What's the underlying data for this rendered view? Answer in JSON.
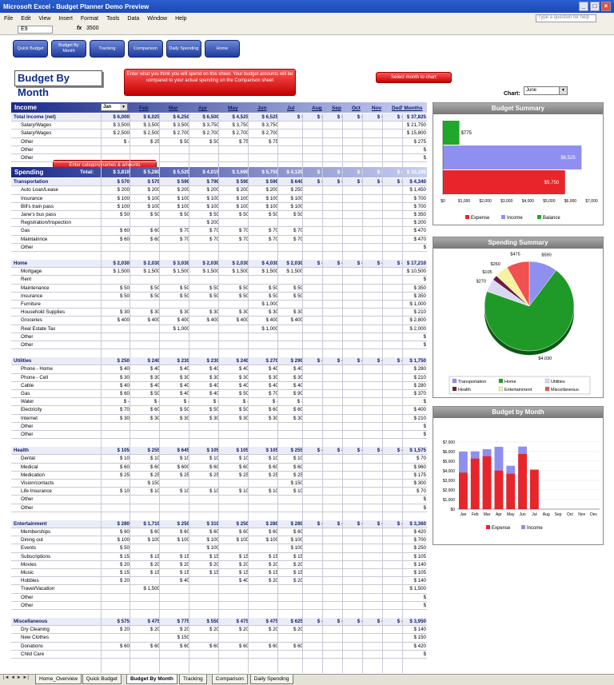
{
  "window": {
    "title": "Microsoft Excel - Budget Planner Demo Preview"
  },
  "menu": [
    "File",
    "Edit",
    "View",
    "Insert",
    "Format",
    "Tools",
    "Data",
    "Window",
    "Help"
  ],
  "ask_placeholder": "Type a question for help",
  "formula": {
    "namebox": "E9",
    "fx": "fx",
    "value": "3500"
  },
  "nav": [
    "Quick Budget",
    "Budget By Month",
    "Tracking",
    "Comparison",
    "Daily Spending",
    "Home"
  ],
  "page_title": "Budget By Month",
  "callouts": {
    "main": "Enter what you think you will spend on this sheet. Your budget amounts will be compared to your actual spending on the Comparison sheet",
    "select": "Select month to chart",
    "category": "Enter category names & amounts"
  },
  "chart_select": {
    "label": "Chart:",
    "value": "June"
  },
  "months": [
    "Jan",
    "Feb",
    "Mar",
    "Apr",
    "May",
    "Jun",
    "Jul",
    "Aug",
    "Sep",
    "Oct",
    "Nov",
    "Dec",
    "7 Months"
  ],
  "income": {
    "header": "Income",
    "month_select": "Jan",
    "rows": [
      {
        "label": "Total Income (net)",
        "tot": true,
        "vals": [
          "$ 6,000",
          "$ 6,025",
          "$ 6,250",
          "$ 6,500",
          "$ 4,525",
          "$ 6,525",
          "$ -",
          "$ -",
          "$ -",
          "$ -",
          "$ -",
          "$ -"
        ],
        "ytd": "$ 37,825"
      },
      {
        "label": "Salary/Wages",
        "vals": [
          "$ 3,500",
          "$ 3,500",
          "$ 3,500",
          "$ 3,750",
          "$ 3,750",
          "$ 3,750",
          "",
          "",
          "",
          "",
          "",
          ""
        ],
        "ytd": "$ 21,750"
      },
      {
        "label": "Salary/Wages",
        "vals": [
          "$ 2,500",
          "$ 2,500",
          "$ 2,700",
          "$ 2,700",
          "$ 2,700",
          "$ 2,700",
          "",
          "",
          "",
          "",
          "",
          ""
        ],
        "ytd": "$ 15,800"
      },
      {
        "label": "Other",
        "vals": [
          "$ -",
          "$ 25",
          "$ 50",
          "$ 50",
          "$ 75",
          "$ 75",
          "",
          "",
          "",
          "",
          "",
          ""
        ],
        "ytd": "$ 275"
      },
      {
        "label": "Other",
        "vals": [
          "",
          "",
          "",
          "",
          "",
          "",
          "",
          "",
          "",
          "",
          "",
          ""
        ],
        "ytd": "$"
      },
      {
        "label": "Other",
        "vals": [
          "",
          "",
          "",
          "",
          "",
          "",
          "",
          "",
          "",
          "",
          "",
          ""
        ],
        "ytd": "$"
      }
    ]
  },
  "spending_header": {
    "label": "Spending",
    "total_label": "Total:",
    "vals": [
      "$ 3,810",
      "$ 5,280",
      "$ 5,520",
      "$ 4,015",
      "$ 3,690",
      "$ 5,750",
      "$ 4,120",
      "$ -",
      "$ -",
      "$ -",
      "$ -",
      "$ -"
    ],
    "ytd": "$ 32,185"
  },
  "groups": [
    {
      "name": "Transportation",
      "vals": [
        "$ 570",
        "$ 570",
        "$ 590",
        "$ 790",
        "$ 590",
        "$ 590",
        "$ 640",
        "$ -",
        "$ -",
        "$ -",
        "$ -",
        "$ -"
      ],
      "ytd": "$ 4,340",
      "rows": [
        {
          "label": "Auto Loan/Lease",
          "vals": [
            "$ 200",
            "$ 200",
            "$ 200",
            "$ 200",
            "$ 200",
            "$ 200",
            "$ 250"
          ],
          "ytd": "$ 1,450"
        },
        {
          "label": "Insurance",
          "vals": [
            "$ 100",
            "$ 100",
            "$ 100",
            "$ 100",
            "$ 100",
            "$ 100",
            "$ 100"
          ],
          "ytd": "$ 700"
        },
        {
          "label": "Bill's train pass",
          "vals": [
            "$ 100",
            "$ 100",
            "$ 100",
            "$ 100",
            "$ 100",
            "$ 100",
            "$ 100"
          ],
          "ytd": "$ 700"
        },
        {
          "label": "Jane's bus pass",
          "vals": [
            "$ 50",
            "$ 50",
            "$ 50",
            "$ 50",
            "$ 50",
            "$ 50",
            "$ 50"
          ],
          "ytd": "$ 350"
        },
        {
          "label": "Registration/Inspection",
          "vals": [
            "",
            "",
            "",
            "$ 200",
            "",
            "",
            ""
          ],
          "ytd": "$ 200"
        },
        {
          "label": "Gas",
          "vals": [
            "$ 60",
            "$ 60",
            "$ 70",
            "$ 70",
            "$ 70",
            "$ 70",
            "$ 70"
          ],
          "ytd": "$ 470"
        },
        {
          "label": "Maintainnce",
          "vals": [
            "$ 60",
            "$ 60",
            "$ 70",
            "$ 70",
            "$ 70",
            "$ 70",
            "$ 70"
          ],
          "ytd": "$ 470"
        },
        {
          "label": "Other",
          "vals": [],
          "ytd": "$"
        }
      ]
    },
    {
      "name": "Home",
      "vals": [
        "$ 2,030",
        "$ 2,030",
        "$ 3,030",
        "$ 2,030",
        "$ 2,030",
        "$ 4,030",
        "$ 2,030",
        "$ -",
        "$ -",
        "$ -",
        "$ -",
        "$ -"
      ],
      "ytd": "$ 17,210",
      "rows": [
        {
          "label": "Mortgage",
          "vals": [
            "$ 1,500",
            "$ 1,500",
            "$ 1,500",
            "$ 1,500",
            "$ 1,500",
            "$ 1,500",
            "$ 1,500"
          ],
          "ytd": "$ 10,500"
        },
        {
          "label": "Rent",
          "vals": [],
          "ytd": "$"
        },
        {
          "label": "Maintenance",
          "vals": [
            "$ 50",
            "$ 50",
            "$ 50",
            "$ 50",
            "$ 50",
            "$ 50",
            "$ 50"
          ],
          "ytd": "$ 350"
        },
        {
          "label": "Insurance",
          "vals": [
            "$ 50",
            "$ 50",
            "$ 50",
            "$ 50",
            "$ 50",
            "$ 50",
            "$ 50"
          ],
          "ytd": "$ 350"
        },
        {
          "label": "Furniture",
          "vals": [
            "",
            "",
            "",
            "",
            "",
            "$ 1,000",
            ""
          ],
          "ytd": "$ 1,000"
        },
        {
          "label": "Household Supplies",
          "vals": [
            "$ 30",
            "$ 30",
            "$ 30",
            "$ 30",
            "$ 30",
            "$ 30",
            "$ 30"
          ],
          "ytd": "$ 210"
        },
        {
          "label": "Groceries",
          "vals": [
            "$ 400",
            "$ 400",
            "$ 400",
            "$ 400",
            "$ 400",
            "$ 400",
            "$ 400"
          ],
          "ytd": "$ 2,800"
        },
        {
          "label": "Real Estate Tax",
          "vals": [
            "",
            "",
            "$ 1,000",
            "",
            "",
            "$ 1,000",
            ""
          ],
          "ytd": "$ 2,000"
        },
        {
          "label": "Other",
          "vals": [],
          "ytd": "$"
        },
        {
          "label": "Other",
          "vals": [],
          "ytd": "$"
        }
      ]
    },
    {
      "name": "Utilities",
      "vals": [
        "$ 250",
        "$ 240",
        "$ 230",
        "$ 230",
        "$ 240",
        "$ 270",
        "$ 290",
        "$ -",
        "$ -",
        "$ -",
        "$ -",
        "$ -"
      ],
      "ytd": "$ 1,750",
      "rows": [
        {
          "label": "Phone - Home",
          "vals": [
            "$ 40",
            "$ 40",
            "$ 40",
            "$ 40",
            "$ 40",
            "$ 40",
            "$ 40"
          ],
          "ytd": "$ 280"
        },
        {
          "label": "Phone - Cell",
          "vals": [
            "$ 30",
            "$ 30",
            "$ 30",
            "$ 30",
            "$ 30",
            "$ 30",
            "$ 30"
          ],
          "ytd": "$ 210"
        },
        {
          "label": "Cable",
          "vals": [
            "$ 40",
            "$ 40",
            "$ 40",
            "$ 40",
            "$ 40",
            "$ 40",
            "$ 40"
          ],
          "ytd": "$ 280"
        },
        {
          "label": "Gas",
          "vals": [
            "$ 60",
            "$ 50",
            "$ 40",
            "$ 40",
            "$ 50",
            "$ 70",
            "$ 90"
          ],
          "ytd": "$ 370"
        },
        {
          "label": "Water",
          "vals": [
            "$ -",
            "$ -",
            "$ -",
            "$ -",
            "$ -",
            "$ -",
            "$ -"
          ],
          "ytd": "$"
        },
        {
          "label": "Electricity",
          "vals": [
            "$ 70",
            "$ 60",
            "$ 50",
            "$ 50",
            "$ 50",
            "$ 60",
            "$ 60"
          ],
          "ytd": "$ 400"
        },
        {
          "label": "Internet",
          "vals": [
            "$ 30",
            "$ 30",
            "$ 30",
            "$ 30",
            "$ 30",
            "$ 30",
            "$ 30"
          ],
          "ytd": "$ 210"
        },
        {
          "label": "Other",
          "vals": [],
          "ytd": "$"
        },
        {
          "label": "Other",
          "vals": [],
          "ytd": "$"
        }
      ]
    },
    {
      "name": "Health",
      "vals": [
        "$ 105",
        "$ 255",
        "$ 645",
        "$ 105",
        "$ 105",
        "$ 105",
        "$ 255",
        "$ -",
        "$ -",
        "$ -",
        "$ -",
        "$ -"
      ],
      "ytd": "$ 1,575",
      "rows": [
        {
          "label": "Dental",
          "vals": [
            "$ 10",
            "$ 10",
            "$ 10",
            "$ 10",
            "$ 10",
            "$ 10",
            "$ 10"
          ],
          "ytd": "$ 70"
        },
        {
          "label": "Medical",
          "vals": [
            "$ 60",
            "$ 60",
            "$ 600",
            "$ 60",
            "$ 60",
            "$ 60",
            "$ 60"
          ],
          "ytd": "$ 960"
        },
        {
          "label": "Medication",
          "vals": [
            "$ 25",
            "$ 25",
            "$ 25",
            "$ 25",
            "$ 25",
            "$ 25",
            "$ 25"
          ],
          "ytd": "$ 175"
        },
        {
          "label": "Vision/contacts",
          "vals": [
            "",
            "$ 150",
            "",
            "",
            "",
            "",
            "$ 150"
          ],
          "ytd": "$ 300"
        },
        {
          "label": "Life Insurance",
          "vals": [
            "$ 10",
            "$ 10",
            "$ 10",
            "$ 10",
            "$ 10",
            "$ 10",
            "$ 10"
          ],
          "ytd": "$ 70"
        },
        {
          "label": "Other",
          "vals": [],
          "ytd": "$"
        },
        {
          "label": "Other",
          "vals": [],
          "ytd": "$"
        }
      ]
    },
    {
      "name": "Entertainment",
      "vals": [
        "$ 280",
        "$ 1,710",
        "$ 250",
        "$ 310",
        "$ 250",
        "$ 280",
        "$ 280",
        "$ -",
        "$ -",
        "$ -",
        "$ -",
        "$ -"
      ],
      "ytd": "$ 3,360",
      "rows": [
        {
          "label": "Memberships",
          "vals": [
            "$ 60",
            "$ 60",
            "$ 60",
            "$ 60",
            "$ 60",
            "$ 60",
            "$ 60"
          ],
          "ytd": "$ 420"
        },
        {
          "label": "Dining out",
          "vals": [
            "$ 100",
            "$ 100",
            "$ 100",
            "$ 100",
            "$ 100",
            "$ 100",
            "$ 100"
          ],
          "ytd": "$ 700"
        },
        {
          "label": "Events",
          "vals": [
            "$ 50",
            "",
            "",
            "$ 100",
            "",
            "",
            "$ 100"
          ],
          "ytd": "$ 250"
        },
        {
          "label": "Subscriptions",
          "vals": [
            "$ 15",
            "$ 15",
            "$ 15",
            "$ 15",
            "$ 15",
            "$ 15",
            "$ 15"
          ],
          "ytd": "$ 105"
        },
        {
          "label": "Movies",
          "vals": [
            "$ 20",
            "$ 20",
            "$ 20",
            "$ 20",
            "$ 20",
            "$ 20",
            "$ 20"
          ],
          "ytd": "$ 140"
        },
        {
          "label": "Music",
          "vals": [
            "$ 15",
            "$ 15",
            "$ 15",
            "$ 15",
            "$ 15",
            "$ 15",
            "$ 15"
          ],
          "ytd": "$ 105"
        },
        {
          "label": "Hobbies",
          "vals": [
            "$ 20",
            "",
            "$ 40",
            "",
            "$ 40",
            "$ 20",
            "$ 20"
          ],
          "ytd": "$ 140"
        },
        {
          "label": "Travel/Vacation",
          "vals": [
            "",
            "$ 1,500",
            "",
            "",
            "",
            "",
            ""
          ],
          "ytd": "$ 1,500"
        },
        {
          "label": "Other",
          "vals": [],
          "ytd": "$"
        },
        {
          "label": "Other",
          "vals": [],
          "ytd": "$"
        }
      ]
    },
    {
      "name": "Miscellaneous",
      "vals": [
        "$ 575",
        "$ 475",
        "$ 775",
        "$ 550",
        "$ 475",
        "$ 475",
        "$ 625",
        "$ -",
        "$ -",
        "$ -",
        "$ -",
        "$ -"
      ],
      "ytd": "$ 3,950",
      "rows": [
        {
          "label": "Dry Cleaning",
          "vals": [
            "$ 20",
            "$ 20",
            "$ 20",
            "$ 20",
            "$ 20",
            "$ 20",
            "$ 20"
          ],
          "ytd": "$ 140"
        },
        {
          "label": "New Clothes",
          "vals": [
            "",
            "",
            "$ 150",
            "",
            "",
            "",
            ""
          ],
          "ytd": "$ 150"
        },
        {
          "label": "Donations",
          "vals": [
            "$ 60",
            "$ 60",
            "$ 60",
            "$ 60",
            "$ 60",
            "$ 60",
            "$ 60"
          ],
          "ytd": "$ 420"
        },
        {
          "label": "Child Care",
          "vals": [],
          "ytd": "$"
        }
      ]
    }
  ],
  "chart_data": [
    {
      "type": "bar",
      "title": "Budget Summary",
      "categories": [
        "Expense",
        "Income",
        "Balance"
      ],
      "values": [
        5750,
        6525,
        775
      ],
      "value_labels": [
        "$5,750",
        "$6,525",
        "$775"
      ],
      "xlim": [
        0,
        7000
      ],
      "ticks": [
        "$0",
        "$1,000",
        "$2,000",
        "$3,000",
        "$4,000",
        "$5,000",
        "$6,000",
        "$7,000"
      ],
      "colors": [
        "#e8252a",
        "#8f8ff0",
        "#1fa82a"
      ],
      "orientation": "horizontal",
      "legend": "bottom"
    },
    {
      "type": "pie",
      "title": "Spending Summary",
      "categories": [
        "Transportation",
        "Home",
        "Utilities",
        "Health",
        "Entertainment",
        "Miscellaneous"
      ],
      "values": [
        590,
        4030,
        270,
        105,
        280,
        475
      ],
      "value_labels": [
        "$590",
        "$4,030",
        "$270",
        "$105",
        "$260",
        "$475"
      ],
      "colors": [
        "#8f8ff0",
        "#1f9a28",
        "#d8d8f0",
        "#6b1a40",
        "#f6f2a0",
        "#f05050"
      ],
      "legend": "bottom"
    },
    {
      "type": "bar",
      "title": "Budget by Month",
      "categories": [
        "Jan",
        "Feb",
        "Mar",
        "Apr",
        "May",
        "Jun",
        "Jul",
        "Aug",
        "Sep",
        "Oct",
        "Nov",
        "Dec"
      ],
      "series": [
        {
          "name": "Expense",
          "values": [
            3810,
            5280,
            5520,
            4015,
            3690,
            5750,
            4120,
            0,
            0,
            0,
            0,
            0
          ]
        },
        {
          "name": "Income",
          "values": [
            6000,
            6025,
            6250,
            6500,
            4525,
            6525,
            0,
            0,
            0,
            0,
            0,
            0
          ]
        }
      ],
      "ylim": [
        0,
        7000
      ],
      "ticks": [
        "$0",
        "$1,000",
        "$2,000",
        "$3,000",
        "$4,000",
        "$5,000",
        "$6,000",
        "$7,000"
      ],
      "colors": [
        "#e8252a",
        "#8f8ff0"
      ],
      "legend": "bottom"
    }
  ],
  "sheet_tabs": [
    "Home_Overview",
    "Quick Budget",
    "Budget By Month",
    "Tracking",
    "Comparison",
    "Daily Spending"
  ],
  "active_tab": "Budget By Month"
}
